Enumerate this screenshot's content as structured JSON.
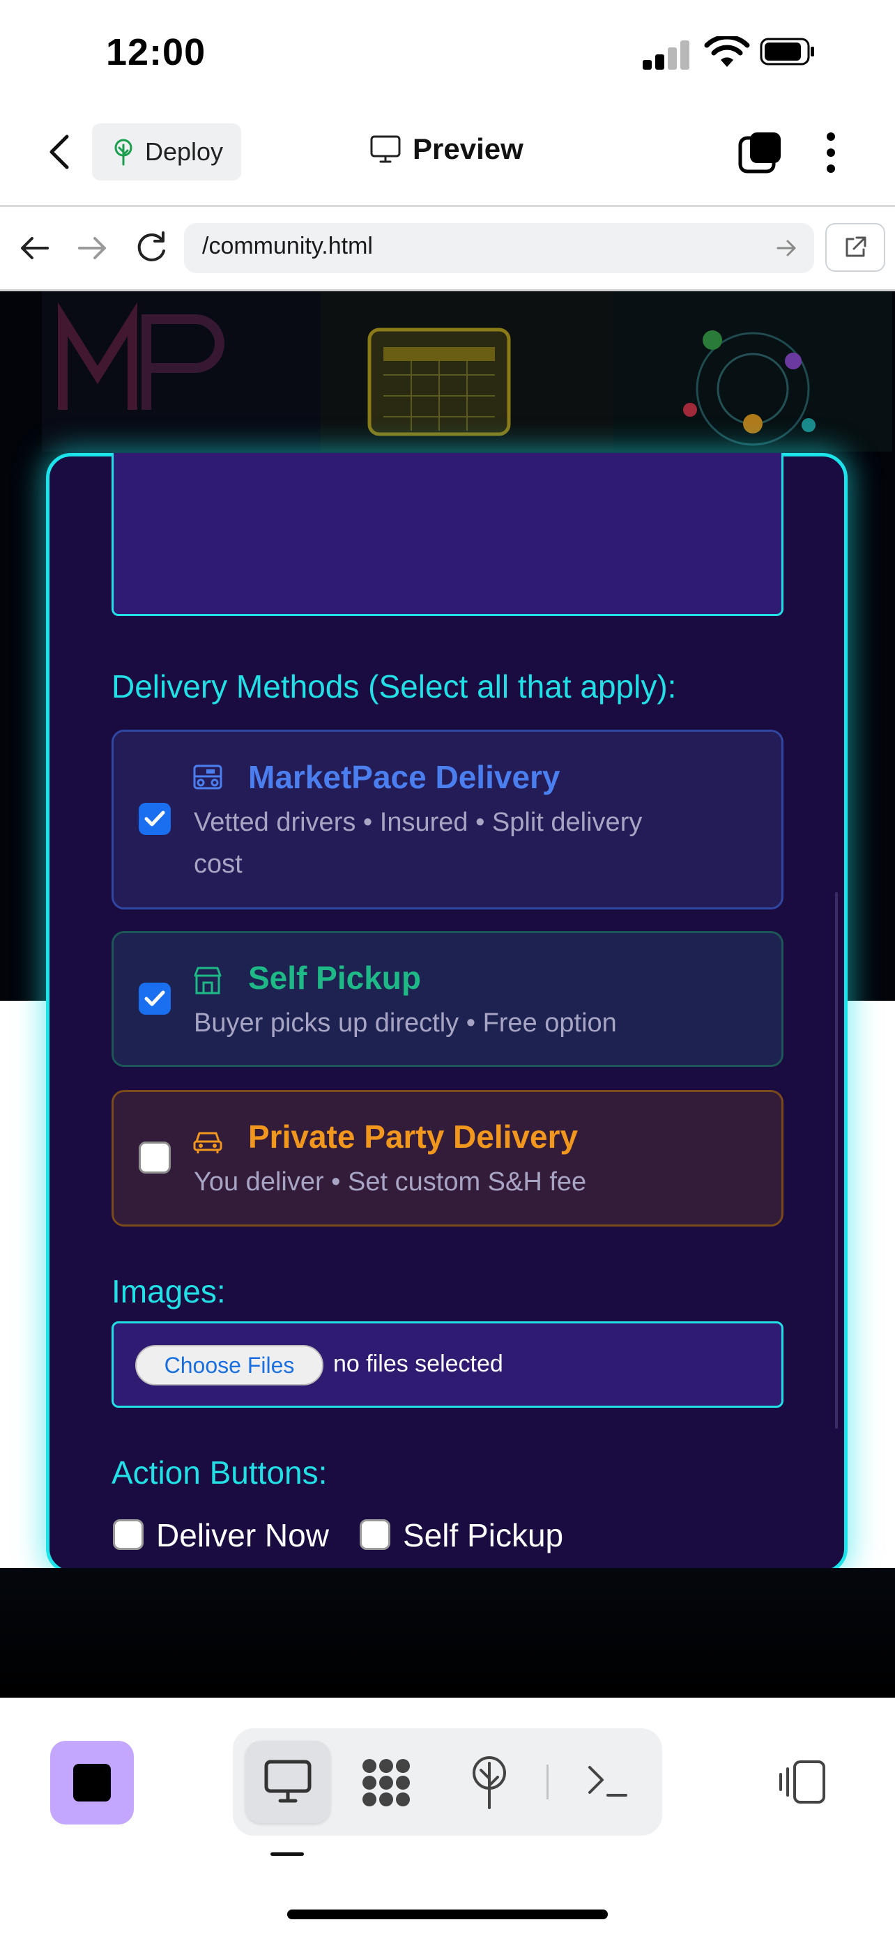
{
  "status_bar": {
    "time": "12:00"
  },
  "top_bar": {
    "deploy_label": "Deploy",
    "preview_label": "Preview"
  },
  "browser": {
    "url": "/community.html"
  },
  "form": {
    "delivery_label": "Delivery Methods (Select all that apply):",
    "options": [
      {
        "title": "MarketPace Delivery",
        "desc_line1": "Vetted drivers • Insured • Split delivery",
        "desc_line2": "cost",
        "checked": true,
        "color": "#4b7ff0"
      },
      {
        "title": "Self Pickup",
        "desc_line1": "Buyer picks up directly • Free option",
        "checked": true,
        "color": "#1fb887"
      },
      {
        "title": "Private Party Delivery",
        "desc_line1": "You deliver • Set custom S&H fee",
        "checked": false,
        "color": "#f2971d"
      }
    ],
    "images_label": "Images:",
    "choose_files": "Choose Files",
    "no_files": "no files selected",
    "action_buttons_label": "Action Buttons:",
    "action_buttons": [
      {
        "label": "Deliver Now",
        "checked": false
      },
      {
        "label": "Self Pickup",
        "checked": false
      }
    ]
  },
  "colors": {
    "accent_cyan": "#1de3ea",
    "card_bg": "#1a0c40",
    "stop_button": "#c3a7ff"
  }
}
